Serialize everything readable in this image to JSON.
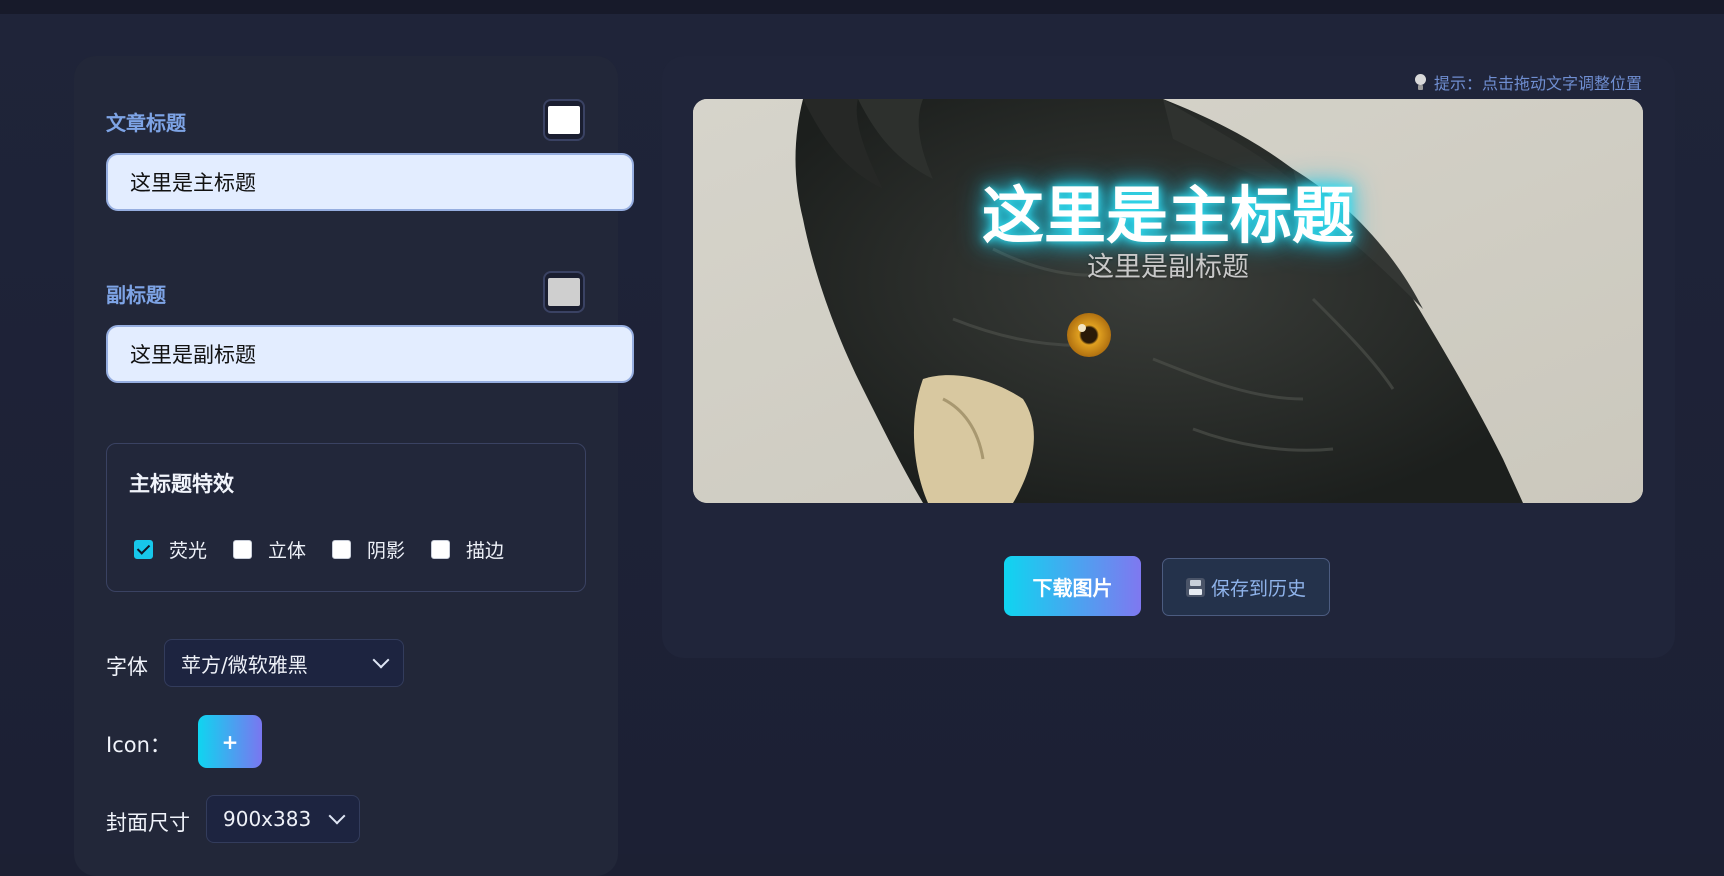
{
  "form": {
    "title_label": "文章标题",
    "title_value": "这里是主标题",
    "title_color": "#ffffff",
    "subtitle_label": "副标题",
    "subtitle_value": "这里是副标题",
    "subtitle_color": "#cfcfcf",
    "effects": {
      "heading": "主标题特效",
      "options": [
        {
          "label": "荧光",
          "checked": true
        },
        {
          "label": "立体",
          "checked": false
        },
        {
          "label": "阴影",
          "checked": false
        },
        {
          "label": "描边",
          "checked": false
        }
      ]
    },
    "font_label": "字体",
    "font_value": "苹方/微软雅黑",
    "icon_label": "Icon：",
    "icon_add_label": "+",
    "size_label": "封面尺寸",
    "size_value": "900x383"
  },
  "preview": {
    "hint": "提示：点击拖动文字调整位置",
    "hint_icon": "lightbulb-icon",
    "title": "这里是主标题",
    "subtitle": "这里是副标题",
    "image_subject": "black cockatoo illustration"
  },
  "actions": {
    "download_label": "下载图片",
    "save_label": "保存到历史",
    "save_icon": "floppy-disk-icon"
  },
  "colors": {
    "accent_gradient_start": "#0fd5f0",
    "accent_gradient_end": "#7f78f0",
    "label_blue": "#7ea4e6",
    "panel_bg": "#222739"
  }
}
